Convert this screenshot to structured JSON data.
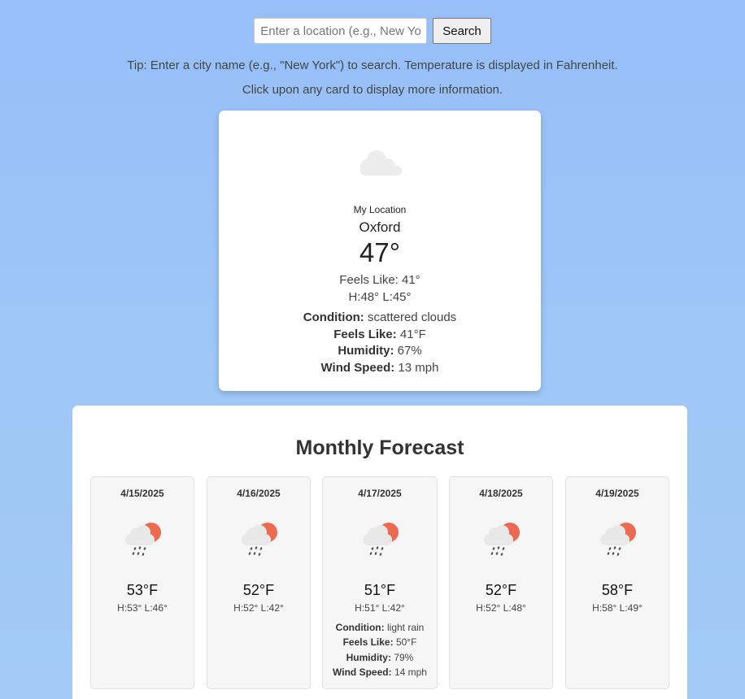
{
  "search": {
    "placeholder": "Enter a location (e.g., New York)",
    "button_label": "Search"
  },
  "tips": {
    "line1": "Tip: Enter a city name (e.g., \"New York\") to search. Temperature is displayed in Fahrenheit.",
    "line2": "Click upon any card to display more information."
  },
  "current": {
    "icon": "cloud-icon",
    "label": "My Location",
    "city": "Oxford",
    "temp": "47°",
    "feels_like": "Feels Like: 41°",
    "hilo": "H:48° L:45°",
    "condition_label": "Condition:",
    "condition_value": "scattered clouds",
    "feels_label": "Feels Like:",
    "feels_value": "41°F",
    "humidity_label": "Humidity:",
    "humidity_value": "67%",
    "wind_label": "Wind Speed:",
    "wind_value": "13 mph"
  },
  "forecast": {
    "title": "Monthly Forecast",
    "days": [
      {
        "date": "4/15/2025",
        "icon": "rain-sun-icon",
        "temp": "53°F",
        "hilo": "H:53° L:46°"
      },
      {
        "date": "4/16/2025",
        "icon": "rain-sun-icon",
        "temp": "52°F",
        "hilo": "H:52° L:42°"
      },
      {
        "date": "4/17/2025",
        "icon": "rain-sun-icon",
        "temp": "51°F",
        "hilo": "H:51° L:42°",
        "condition_label": "Condition:",
        "condition_value": "light rain",
        "feels_label": "Feels Like:",
        "feels_value": "50°F",
        "humidity_label": "Humidity:",
        "humidity_value": "79%",
        "wind_label": "Wind Speed:",
        "wind_value": "14 mph"
      },
      {
        "date": "4/18/2025",
        "icon": "rain-sun-icon",
        "temp": "52°F",
        "hilo": "H:52° L:48°"
      },
      {
        "date": "4/19/2025",
        "icon": "rain-sun-icon",
        "temp": "58°F",
        "hilo": "H:58° L:49°"
      }
    ]
  },
  "colors": {
    "background": "#97bff8",
    "sun": "#ec6a4f",
    "cloud": "#ececec"
  }
}
